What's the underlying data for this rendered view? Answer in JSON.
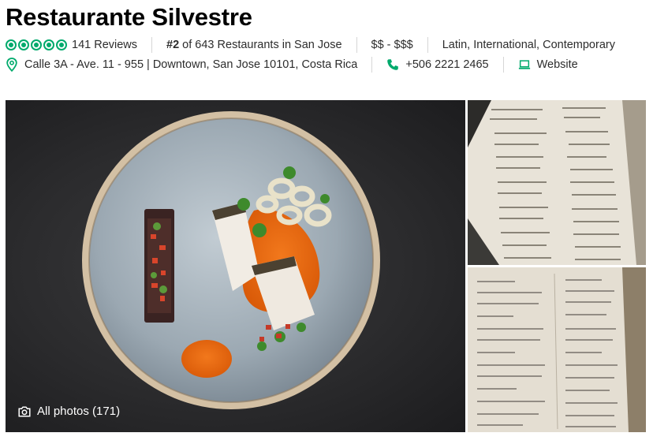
{
  "restaurant": {
    "name": "Restaurante Silvestre",
    "rating_bubbles": 5,
    "reviews": "141 Reviews",
    "rank_prefix": "#2",
    "rank_rest": " of 643 Restaurants in San Jose",
    "price": "$$ - $$$",
    "cuisines": "Latin, International, Contemporary",
    "address": "Calle 3A - Ave. 11 - 955 | Downtown, San Jose 10101, Costa Rica",
    "phone": "+506 2221 2465",
    "website": "Website"
  },
  "photos": {
    "all_photos_label": "All photos (171)"
  },
  "colors": {
    "brand_green": "#00aa6c",
    "text": "#2c2c2c",
    "separator": "#d6d6d6"
  },
  "icons": [
    "map-pin-icon",
    "phone-icon",
    "laptop-icon",
    "camera-icon",
    "rating-bubble-icon"
  ]
}
